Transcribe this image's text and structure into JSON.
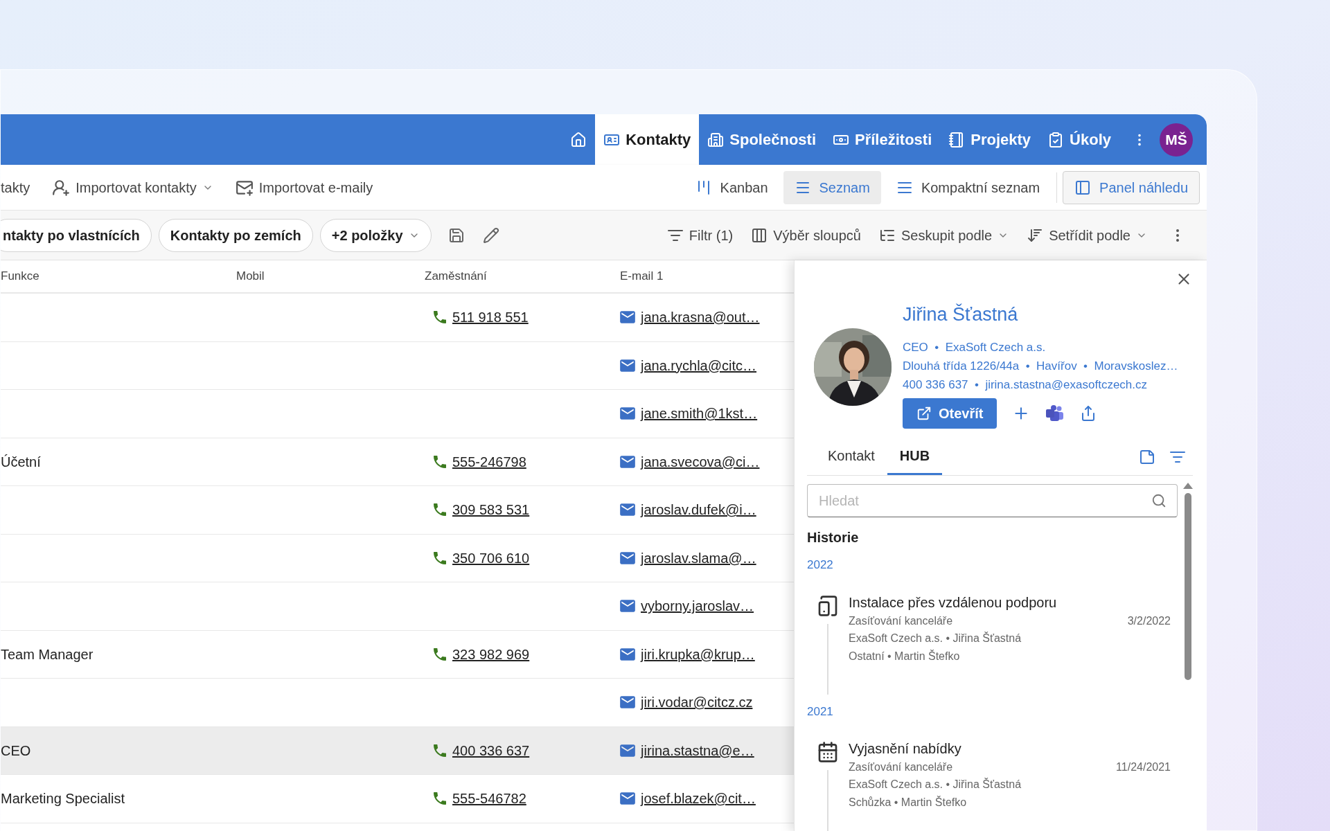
{
  "nav": {
    "items": [
      {
        "kind": "home",
        "selected": false
      },
      {
        "kind": "contacts",
        "label": "Kontakty",
        "selected": true
      },
      {
        "kind": "companies",
        "label": "Společnosti",
        "selected": false
      },
      {
        "kind": "opportunities",
        "label": "Příležitosti",
        "selected": false
      },
      {
        "kind": "projects",
        "label": "Projekty",
        "selected": false
      },
      {
        "kind": "tasks",
        "label": "Úkoly",
        "selected": false
      }
    ],
    "avatar": "MŠ"
  },
  "commands": [
    {
      "kind": "text",
      "label": "takty",
      "dropdown": false
    },
    {
      "kind": "import-contacts",
      "label": "Importovat kontakty",
      "dropdown": true
    },
    {
      "kind": "import-emails",
      "label": "Importovat e-maily",
      "dropdown": false
    }
  ],
  "views": [
    {
      "kind": "kanban",
      "label": "Kanban",
      "selected": false
    },
    {
      "kind": "list",
      "label": "Seznam",
      "selected": true
    },
    {
      "kind": "compact",
      "label": "Kompaktní seznam",
      "selected": false
    }
  ],
  "preview_toggle": {
    "label": "Panel náhledu",
    "on": true
  },
  "saved_views": [
    {
      "label": "ntakty po vlastnících",
      "dropdown": false
    },
    {
      "label": "Kontakty po zemích",
      "dropdown": false
    },
    {
      "label": "+2 položky",
      "dropdown": true
    }
  ],
  "actions": [
    {
      "kind": "filter",
      "label": "Filtr (1)",
      "dropdown": false
    },
    {
      "kind": "columns",
      "label": "Výběr sloupců",
      "dropdown": false
    },
    {
      "kind": "group",
      "label": "Seskupit podle",
      "dropdown": true
    },
    {
      "kind": "sort",
      "label": "Setřídit podle",
      "dropdown": true
    }
  ],
  "table": {
    "columns": [
      "Funkce",
      "Mobil",
      "Zaměstnání",
      "E-mail 1"
    ],
    "rows": [
      {
        "zamestnani": "511 918 551",
        "email_1": "jana.krasna@out…",
        "selected": false
      },
      {
        "email_1": "jana.rychla@citc…",
        "selected": false
      },
      {
        "email_1": "jane.smith@1kst…",
        "selected": false
      },
      {
        "funkce": "Účetní",
        "zamestnani": "555-246798",
        "email_1": "jana.svecova@ci…",
        "selected": false
      },
      {
        "zamestnani": "309 583 531",
        "email_1": "jaroslav.dufek@i…",
        "selected": false
      },
      {
        "zamestnani": "350 706 610",
        "email_1": "jaroslav.slama@…",
        "selected": false
      },
      {
        "email_1": "vyborny.jaroslav…",
        "selected": false
      },
      {
        "funkce": "Team Manager",
        "zamestnani": "323 982 969",
        "email_1": "jiri.krupka@krup…",
        "selected": false
      },
      {
        "email_1": "jiri.vodar@citcz.cz",
        "selected": false
      },
      {
        "funkce": "CEO",
        "zamestnani": "400 336 637",
        "email_1": "jirina.stastna@e…",
        "selected": true
      },
      {
        "funkce": "Marketing Specialist",
        "zamestnani": "555-546782",
        "email_1": "josef.blazek@cit…",
        "selected": false
      }
    ]
  },
  "preview": {
    "name": "Jiřina Šťastná",
    "details": [
      "CEO  •  ExaSoft Czech a.s.",
      "Dlouhá třída 1226/44a  •  Havířov  •  Moravskoslez…",
      "400 336 637  •  jirina.stastna@exasoftczech.cz"
    ],
    "open_button": "Otevřít",
    "tabs": [
      {
        "label": "Kontakt",
        "selected": false
      },
      {
        "label": "HUB",
        "selected": true
      }
    ],
    "search": {
      "placeholder": "Hledat"
    },
    "history_title": "Historie",
    "groups": [
      {
        "year": "2022",
        "items": [
          {
            "kind": "remote",
            "title": "Instalace přes vzdálenou podporu",
            "subtitle": "Zasíťování kanceláře",
            "date": "3/2/2022",
            "lines": [
              "ExaSoft Czech a.s. • Jiřina Šťastná",
              "Ostatní • Martin Štefko"
            ]
          }
        ]
      },
      {
        "year": "2021",
        "items": [
          {
            "kind": "meeting",
            "title": "Vyjasnění nabídky",
            "subtitle": "Zasíťování kanceláře",
            "date": "11/24/2021",
            "lines": [
              "ExaSoft Czech a.s. • Jiřina Šťastná",
              "Schůzka • Martin Štefko"
            ]
          }
        ]
      }
    ]
  }
}
